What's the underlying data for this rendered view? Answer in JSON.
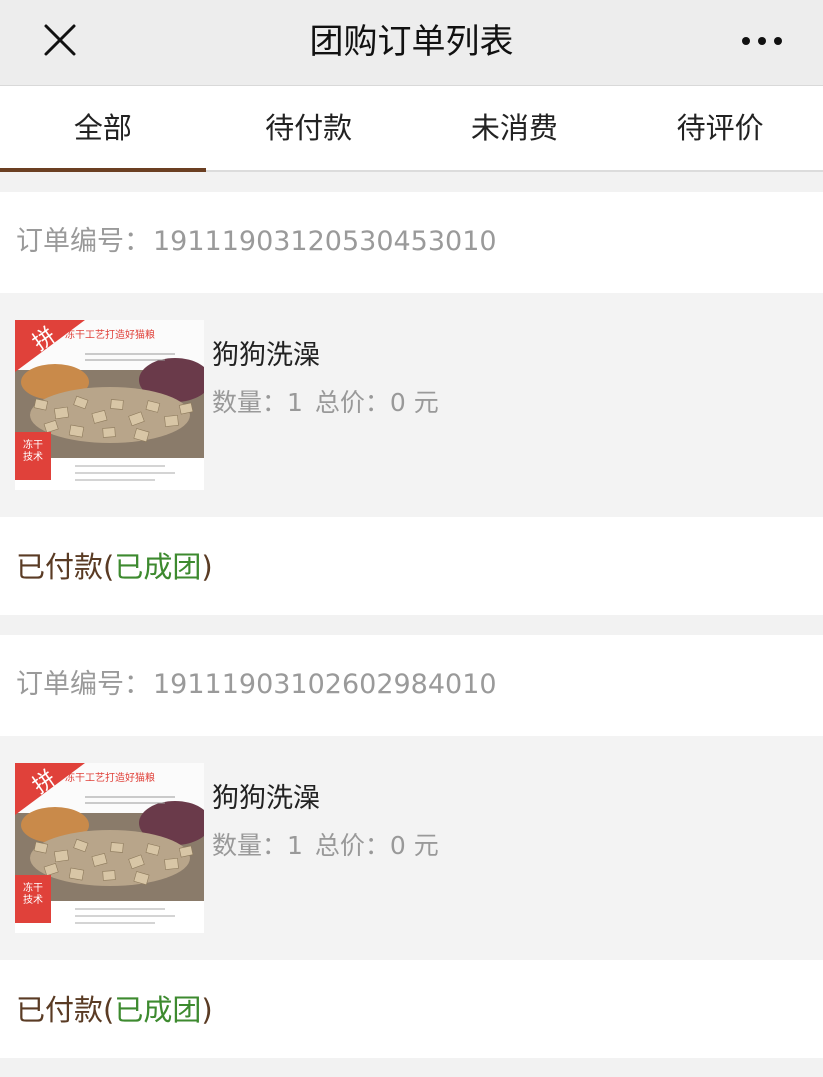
{
  "header": {
    "title": "团购订单列表",
    "close_icon": "close-icon",
    "more_icon": "more-dots-icon"
  },
  "tabs": [
    {
      "label": "全部",
      "active": true
    },
    {
      "label": "待付款",
      "active": false
    },
    {
      "label": "未消费",
      "active": false
    },
    {
      "label": "待评价",
      "active": false
    }
  ],
  "orders": [
    {
      "order_no_label": "订单编号：",
      "order_no": "19111903120530453010",
      "product": {
        "name": "狗狗洗澡",
        "qty_label": "数量：",
        "qty": "1",
        "total_label": "总价：",
        "total": "0",
        "unit": "元",
        "image_badge": "拼",
        "image_banner": "冻干工艺打造好猫粮",
        "image_tag": "冻干技术"
      },
      "status": {
        "main": "已付款",
        "open": "(",
        "sub": "已成团",
        "close": ")"
      }
    },
    {
      "order_no_label": "订单编号：",
      "order_no": "19111903102602984010",
      "product": {
        "name": "狗狗洗澡",
        "qty_label": "数量：",
        "qty": "1",
        "total_label": "总价：",
        "total": "0",
        "unit": "元",
        "image_badge": "拼",
        "image_banner": "冻干工艺打造好猫粮",
        "image_tag": "冻干技术"
      },
      "status": {
        "main": "已付款",
        "open": "(",
        "sub": "已成团",
        "close": ")"
      }
    }
  ],
  "colors": {
    "accent_underline": "#6b3f22",
    "status_brown": "#5a3b24",
    "status_green": "#3d8a2f",
    "badge_red": "#e0413a"
  }
}
